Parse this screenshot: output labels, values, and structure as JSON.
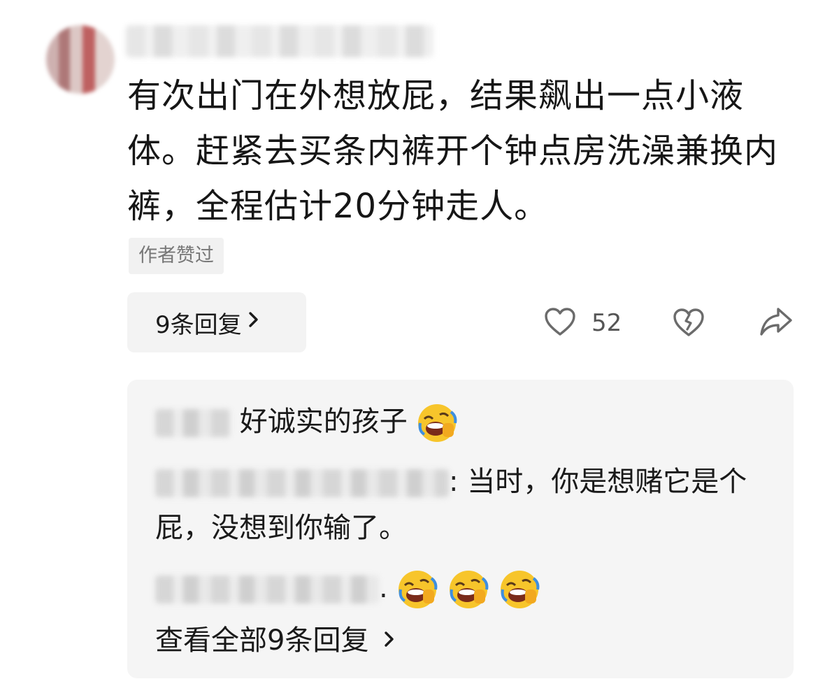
{
  "comment": {
    "text": "有次出门在外想放屁，结果飙出一点小液体。赶紧去买条内裤开个钟点房洗澡兼换内裤，全程估计20分钟走人。",
    "author_liked_badge": "作者赞过",
    "replies_button_label": "9条回复",
    "like_count": "52"
  },
  "replies": [
    {
      "text": "好诚实的孩子",
      "emoji_count": 1
    },
    {
      "text": ": 当时，你是想赌它是个屁，没想到你输了。"
    },
    {
      "text": ".",
      "emoji_count": 3
    }
  ],
  "view_all_label": "查看全部9条回复",
  "icons": {
    "like": "heart-outline-icon",
    "dislike": "broken-heart-icon",
    "share": "share-arrow-icon",
    "chevron": "chevron-right-icon",
    "emoji": "rolling-laughing-emoji"
  },
  "colors": {
    "text": "#1a1a1a",
    "muted": "#777777",
    "panel": "#f5f5f5",
    "emoji_yellow": "#f7c52b",
    "emoji_blue": "#3e8fe0"
  }
}
